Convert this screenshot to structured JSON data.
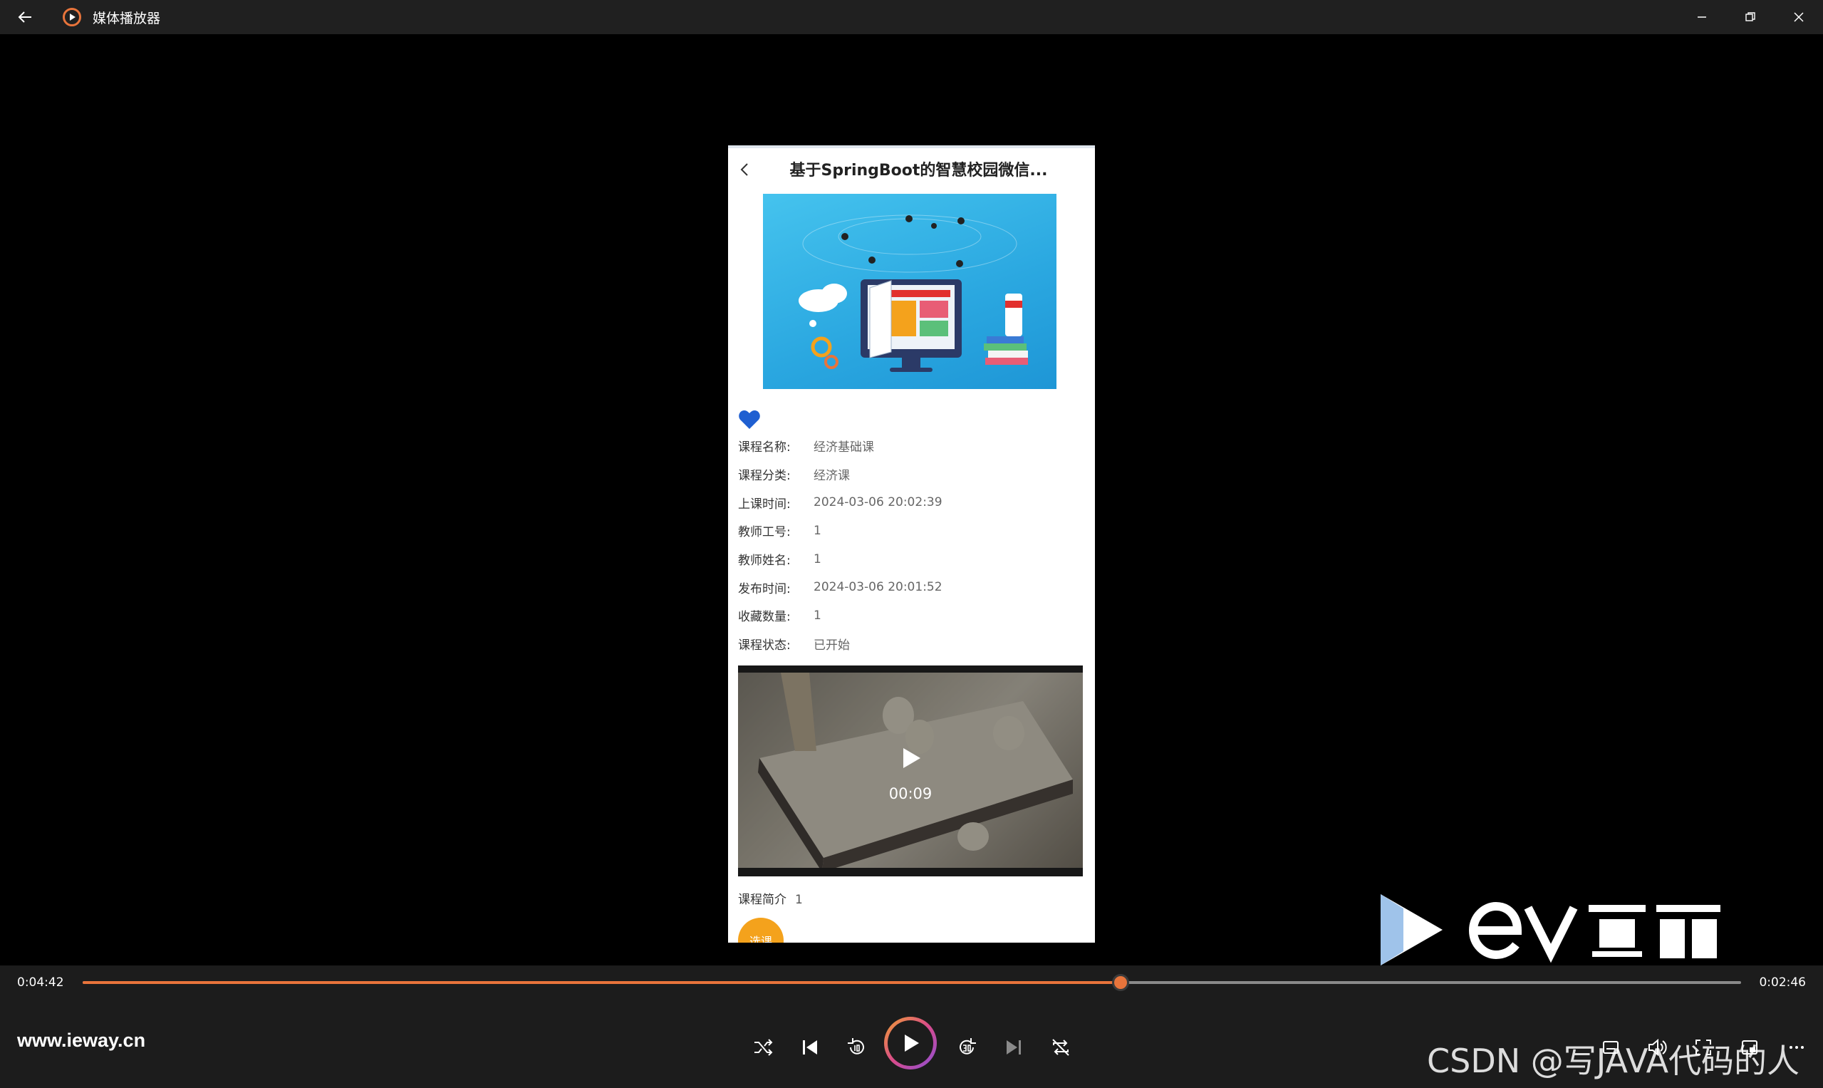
{
  "window": {
    "title": "媒体播放器"
  },
  "app": {
    "header_title": "基于SpringBoot的智慧校园微信...",
    "fields": [
      {
        "label": "课程名称:",
        "value": "经济基础课"
      },
      {
        "label": "课程分类:",
        "value": "经济课"
      },
      {
        "label": "上课时间:",
        "value": "2024-03-06 20:02:39"
      },
      {
        "label": "教师工号:",
        "value": "1"
      },
      {
        "label": "教师姓名:",
        "value": "1"
      },
      {
        "label": "发布时间:",
        "value": "2024-03-06 20:01:52"
      },
      {
        "label": "收藏数量:",
        "value": "1"
      },
      {
        "label": "课程状态:",
        "value": "已开始"
      }
    ],
    "video_time": "00:09",
    "desc_label": "课程简介",
    "desc_value": "1",
    "enroll_label": "选课"
  },
  "player": {
    "current_time": "0:04:42",
    "total_time": "0:02:46",
    "progress": 0.626,
    "site": "www.ieway.cn"
  },
  "watermark": {
    "text": "CSDN @写JAVA代码的人"
  },
  "colors": {
    "accent": "#e8743b",
    "heart": "#1f5fd1",
    "enroll": "#f4a21c"
  }
}
